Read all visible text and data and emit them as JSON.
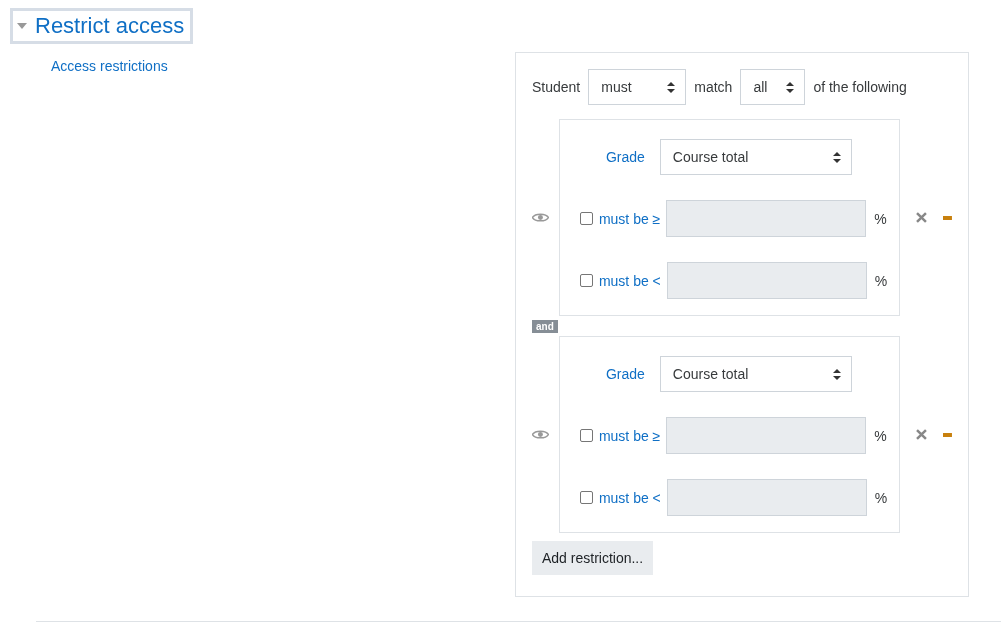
{
  "section": {
    "title": "Restrict access",
    "expanded": true
  },
  "field_label": "Access restrictions",
  "match_row": {
    "prefix": "Student",
    "must_select": "must",
    "middle": "match",
    "all_select": "all",
    "suffix": "of the following"
  },
  "conditions": [
    {
      "grade_label": "Grade",
      "grade_select": "Course total",
      "rows": [
        {
          "label": "must be ≥",
          "checked": false,
          "unit": "%"
        },
        {
          "label": "must be <",
          "checked": false,
          "unit": "%"
        }
      ]
    },
    {
      "grade_label": "Grade",
      "grade_select": "Course total",
      "rows": [
        {
          "label": "must be ≥",
          "checked": false,
          "unit": "%"
        },
        {
          "label": "must be <",
          "checked": false,
          "unit": "%"
        }
      ]
    }
  ],
  "connector": "and",
  "add_button": "Add restriction..."
}
